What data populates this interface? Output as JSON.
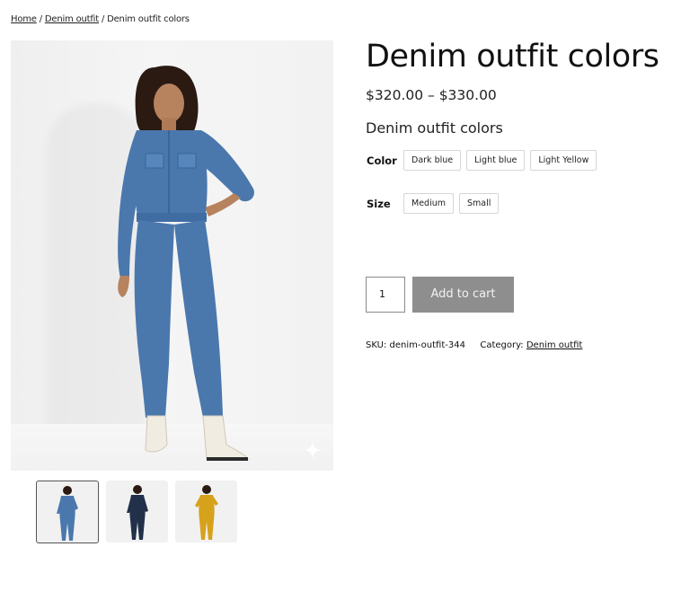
{
  "breadcrumb": {
    "home": "Home",
    "sep1": "/",
    "category": "Denim outfit",
    "sep2": "/",
    "current": "Denim outfit colors"
  },
  "product": {
    "title": "Denim outfit colors",
    "price": "$320.00 – $330.00",
    "short_description": "Denim outfit colors",
    "quantity": "1",
    "add_to_cart": "Add to cart"
  },
  "options": {
    "color": {
      "label": "Color",
      "values": [
        "Dark blue",
        "Light blue",
        "Light Yellow"
      ]
    },
    "size": {
      "label": "Size",
      "values": [
        "Medium",
        "Small"
      ]
    }
  },
  "meta": {
    "sku_label": "SKU:",
    "sku": "denim-outfit-344",
    "category_label": "Category:",
    "category": "Denim outfit"
  },
  "colors": {
    "denim": "#4a78ad",
    "dark_denim": "#23304a",
    "mustard": "#d6a21c",
    "button_bg": "#8e8e8e"
  },
  "icons": {
    "image_zoom": "sparkle-icon"
  }
}
